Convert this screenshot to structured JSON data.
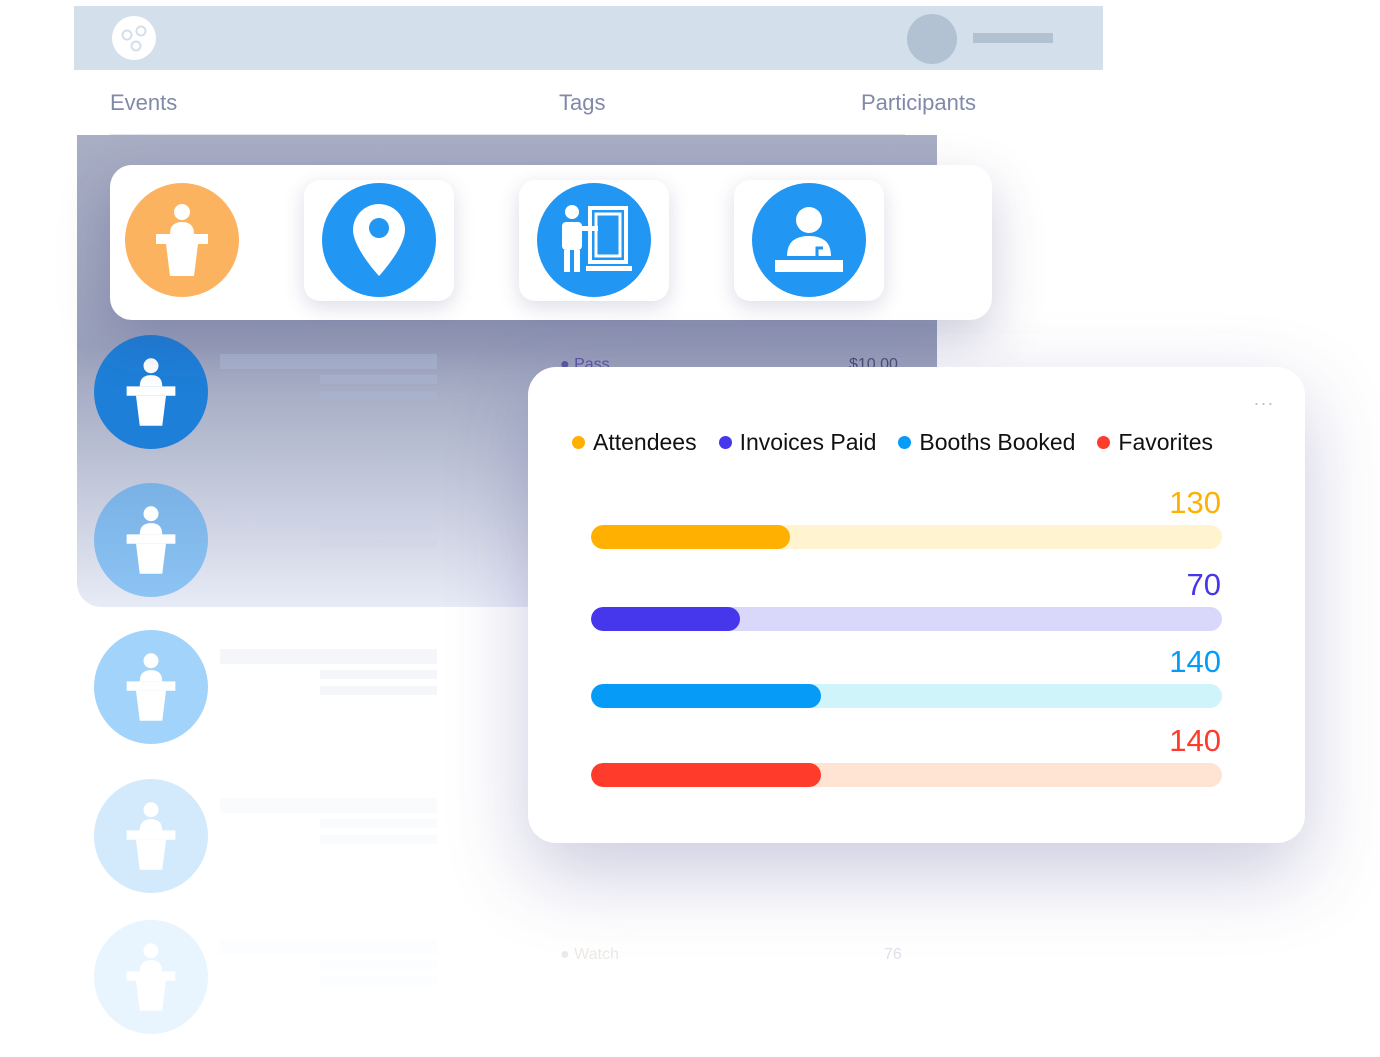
{
  "header": {
    "logo": "app-logo"
  },
  "tabs": [
    {
      "label": "Events"
    },
    {
      "label": "Tags"
    },
    {
      "label": "Participants"
    }
  ],
  "tiles": [
    {
      "icon": "speaker-podium-icon",
      "color": "#fbb360"
    },
    {
      "icon": "location-pin-icon",
      "color": "#2196f3"
    },
    {
      "icon": "presenter-board-icon",
      "color": "#2196f3"
    },
    {
      "icon": "user-desk-icon",
      "color": "#2196f3"
    }
  ],
  "rows": [
    {
      "tag": "Pass",
      "value": "$10.00"
    },
    {
      "tag": "Watch",
      "value": "76"
    }
  ],
  "chart_data": {
    "type": "bar",
    "orientation": "horizontal",
    "legend_position": "top",
    "series": [
      {
        "name": "Attendees",
        "value": 130,
        "fill_percent": 31.6,
        "color": "#ffb000",
        "track": "#fff4cf"
      },
      {
        "name": "Invoices Paid",
        "value": 70,
        "fill_percent": 23.6,
        "color": "#4636ec",
        "track": "#d9d7fa"
      },
      {
        "name": "Booths Booked",
        "value": 140,
        "fill_percent": 36.4,
        "color": "#079bf8",
        "track": "#cff5fb"
      },
      {
        "name": "Favorites",
        "value": 140,
        "fill_percent": 36.4,
        "color": "#ff3b2b",
        "track": "#ffe4d3"
      }
    ],
    "labels": {
      "series": [
        "Attendees",
        "Invoices Paid",
        "Booths Booked",
        "Favorites"
      ],
      "values": [
        "130",
        "70",
        "140",
        "140"
      ]
    },
    "menu": "..."
  }
}
